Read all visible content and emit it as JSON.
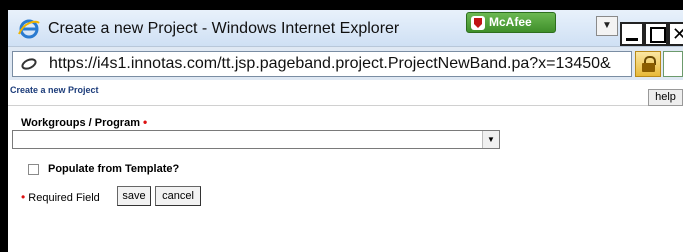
{
  "window": {
    "title": "Create a new Project - Windows Internet Explorer",
    "toolbar_badge": "McAfee",
    "url": "https://i4s1.innotas.com/tt.jsp.pageband.project.ProjectNewBand.pa?x=13450&"
  },
  "page": {
    "title": "Create a new Project",
    "help_label": "help",
    "workgroups_label": "Workgroups / Program",
    "required_marker": "•",
    "select_value": "",
    "template_label": "Populate from Template?",
    "required_field_text": "Required Field",
    "save_label": "save",
    "cancel_label": "cancel"
  },
  "colors": {
    "required": "#dd1111",
    "page_title": "#1c3c7a",
    "mcafee": "#4f9e37"
  },
  "icons": [
    "ie-logo-icon",
    "mcafee-shield-icon",
    "page-icon",
    "lock-icon",
    "rss-page-icon",
    "dropdown-arrow-icon"
  ]
}
